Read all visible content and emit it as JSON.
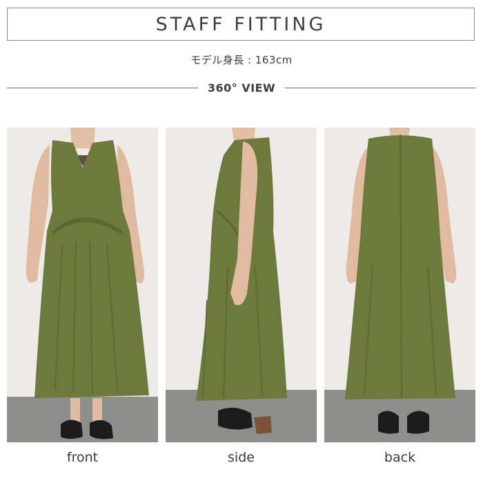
{
  "header": {
    "title": "STAFF FITTING",
    "model_height": "モデル身長 : 163cm",
    "view_label": "360° VIEW"
  },
  "photos": [
    {
      "caption": "front",
      "image": "model-front-photo"
    },
    {
      "caption": "side",
      "image": "model-side-photo"
    },
    {
      "caption": "back",
      "image": "model-back-photo"
    }
  ],
  "colors": {
    "dress": "#6e7a3c",
    "dress_shadow": "#5c6732",
    "wall": "#ededeb",
    "floor": "#8c8c8a",
    "skin": "#e2bfa3",
    "shoe": "#1c1c1c",
    "text": "#3d3d3d"
  }
}
